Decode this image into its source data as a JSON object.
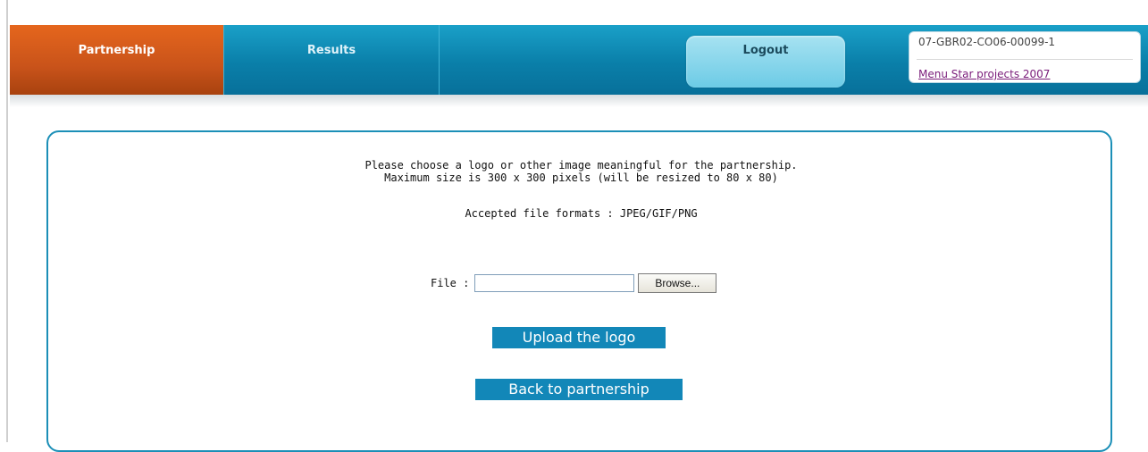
{
  "nav": {
    "tabs": [
      {
        "label": "Partnership",
        "active": true
      },
      {
        "label": "Results",
        "active": false
      }
    ],
    "logout_label": "Logout",
    "project_code": "07-GBR02-CO06-00099-1",
    "project_link": "Menu Star projects 2007"
  },
  "upload": {
    "intro_line1": "Please choose a logo or other image meaningful for the partnership.",
    "intro_line2": "Maximum size is 300 x 300 pixels (will be resized to 80 x 80)",
    "formats": "Accepted file formats : JPEG/GIF/PNG",
    "file_label": "File :",
    "file_value": "",
    "browse_label": "Browse...",
    "upload_button": "Upload the logo",
    "back_button": "Back to partnership"
  },
  "colors": {
    "active_tab": "#c9531a",
    "navbar": "#0a7fa9",
    "button": "#1287b8",
    "panel_border": "#1b8fb7",
    "visited_link": "#7a1c7a"
  }
}
